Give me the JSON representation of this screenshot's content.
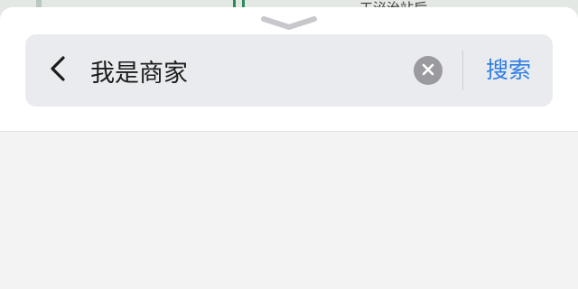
{
  "map_peek": {
    "label_partial": "工泌治站后"
  },
  "search": {
    "query": "我是商家",
    "submit_label": "搜索"
  },
  "icons": {
    "grabber": "chevron-down-icon",
    "back": "chevron-left-icon",
    "clear": "close-circle-icon"
  },
  "colors": {
    "accent": "#2f7ee6",
    "search_field_bg": "#e9ebee",
    "clear_icon_bg": "#9b9b9f"
  }
}
